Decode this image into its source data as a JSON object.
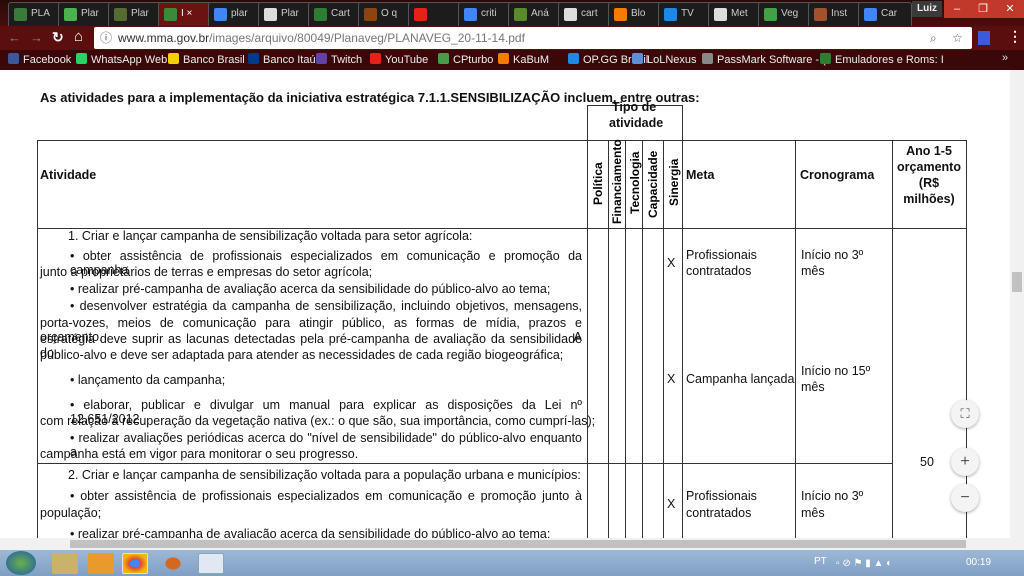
{
  "browser": {
    "tabs": [
      {
        "label": "PLA",
        "color": "#3a7a3a"
      },
      {
        "label": "Plar",
        "color": "#4caf50"
      },
      {
        "label": "Plar",
        "color": "#556b2f"
      },
      {
        "label": "I",
        "color": "#3a8a3a",
        "active": true
      },
      {
        "label": "plar",
        "color": "#4285f4"
      },
      {
        "label": "Plar",
        "color": "#ddd"
      },
      {
        "label": "Cart",
        "color": "#2e7d32"
      },
      {
        "label": "O q",
        "color": "#8b4513"
      },
      {
        "label": "",
        "color": "#e62117"
      },
      {
        "label": "criti",
        "color": "#4285f4"
      },
      {
        "label": "Aná",
        "color": "#5a8a2a"
      },
      {
        "label": "cart",
        "color": "#ddd"
      },
      {
        "label": "Blo",
        "color": "#f57c00"
      },
      {
        "label": "TV",
        "color": "#1e88e5"
      },
      {
        "label": "Met",
        "color": "#ddd"
      },
      {
        "label": "Veg",
        "color": "#43a047"
      },
      {
        "label": "Inst",
        "color": "#a0522d"
      },
      {
        "label": "Car",
        "color": "#4285f4"
      }
    ],
    "user": "Luiz",
    "url_host": "www.mma.gov.br",
    "url_path": "/images/arquivo/80049/Planaveg/PLANAVEG_20-11-14.pdf",
    "bookmarks": [
      {
        "label": "Facebook",
        "color": "#3b5998"
      },
      {
        "label": "WhatsApp Web",
        "color": "#25d366"
      },
      {
        "label": "Banco Brasil",
        "color": "#f5d000"
      },
      {
        "label": "Banco Itaú",
        "color": "#003a8c"
      },
      {
        "label": "Twitch",
        "color": "#6441a5"
      },
      {
        "label": "YouTube",
        "color": "#e62117"
      },
      {
        "label": "CPturbo",
        "color": "#4a9a4a"
      },
      {
        "label": "KaBuM",
        "color": "#f57c00"
      },
      {
        "label": "OP.GG Brazil",
        "color": "#1e88e5"
      },
      {
        "label": "LoLNexus",
        "color": "#5c8fd6"
      },
      {
        "label": "PassMark Software - (",
        "color": "#888"
      },
      {
        "label": "Emuladores e Roms: I",
        "color": "#2e7d32"
      }
    ],
    "bookmarks_more": "»"
  },
  "document": {
    "heading": "As atividades para a implementação da iniciativa estratégica 7.1.1.SENSIBILIZAÇÃO incluem, entre outras:",
    "tipo_header": [
      "Tipo de",
      "atividade"
    ],
    "columns": {
      "atividade": "Atividade",
      "politica": "Política",
      "financiamento": "Financiamento",
      "tecnologia": "Tecnologia",
      "capacidade": "Capacidade",
      "sinergia": "Sinergia",
      "meta": "Meta",
      "cronograma": "Cronograma",
      "orcamento": [
        "Ano 1-5",
        "orçamento",
        "(R$",
        "milhões)"
      ]
    },
    "row1": {
      "title": "1.  Criar e lançar campanha de sensibilização voltada para setor agrícola:",
      "lines": [
        "• obter assistência de profissionais especializados em comunicação e promoção da campanha",
        "junto a proprietários de terras e empresas do setor agrícola;",
        "• realizar pré-campanha de avaliação acerca da sensibilidade do público-alvo ao tema;",
        "• desenvolver estratégia da campanha de sensibilização, incluindo objetivos, mensagens,",
        "porta-vozes, meios de comunicação para atingir público, as formas de mídia, prazos e orçamento. A",
        "estratégia deve suprir as lacunas detectadas pela pré-campanha de avaliação da sensibilidade do",
        "público-alvo e deve ser adaptada para atender as necessidades de cada região biogeográfica;",
        "• lançamento da campanha;",
        "• elaborar, publicar e divulgar um manual para explicar as disposições da Lei nº 12.651/2012",
        "com relação à recuperação da vegetação nativa (ex.: o que são, sua importância, como cumprí-las);",
        "• realizar avaliações periódicas acerca do \"nível de sensibilidade\" do público-alvo enquanto a",
        "campanha está em vigor para monitorar o seu progresso."
      ],
      "marks": [
        "X",
        "X"
      ],
      "meta": [
        [
          "Profissionais",
          "contratados"
        ],
        [
          "Campanha lançada"
        ]
      ],
      "cronograma": [
        [
          "Início no 3º",
          "mês"
        ],
        [
          "Início no 15º",
          "mês"
        ]
      ]
    },
    "orcamento_value": "50",
    "row2": {
      "title": "2.  Criar e lançar campanha de sensibilização voltada para a população urbana e municípios:",
      "lines": [
        "• obter assistência de profissionais especializados em comunicação e promoção junto à",
        "população;",
        "• realizar pré-campanha de avaliação acerca da sensibilidade do público-alvo ao tema;"
      ],
      "marks": [
        "X"
      ],
      "meta": [
        [
          "Profissionais",
          "contratados"
        ]
      ],
      "cronograma": [
        [
          "Início no 3º",
          "mês"
        ]
      ]
    }
  },
  "zoom_controls": {
    "fit": "⛶",
    "plus": "+",
    "minus": "−"
  },
  "taskbar": {
    "lang": "PT",
    "time": "00:19"
  }
}
